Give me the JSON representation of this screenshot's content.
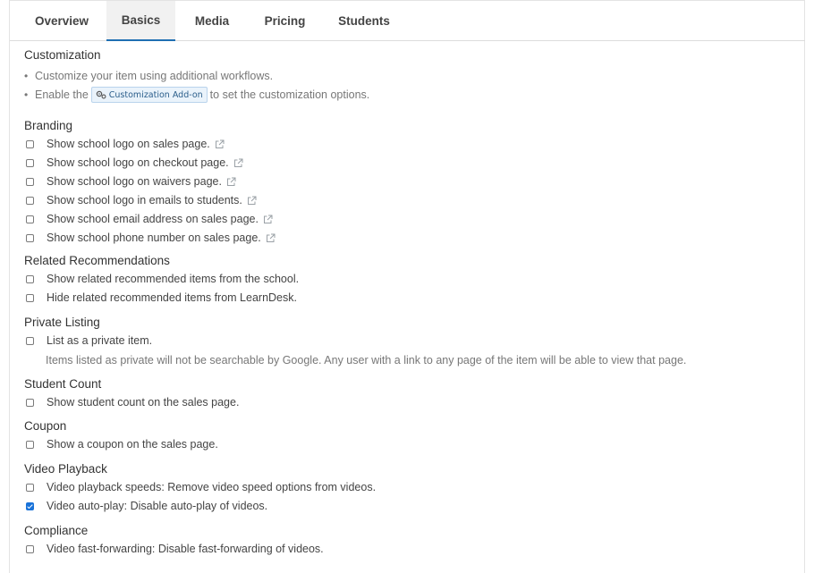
{
  "tabs": [
    "Overview",
    "Basics",
    "Media",
    "Pricing",
    "Students"
  ],
  "active_tab": "Basics",
  "customization": {
    "title": "Customization",
    "bullet1": "Customize your item using additional workflows.",
    "bullet2_prefix": "Enable the",
    "addon_label": "Customization Add-on",
    "bullet2_suffix": "to set the customization options."
  },
  "branding": {
    "title": "Branding",
    "items": [
      {
        "label": "Show school logo on sales page.",
        "checked": false
      },
      {
        "label": "Show school logo on checkout page.",
        "checked": false
      },
      {
        "label": "Show school logo on waivers page.",
        "checked": false
      },
      {
        "label": "Show school logo in emails to students.",
        "checked": false
      },
      {
        "label": "Show school email address on sales page.",
        "checked": false
      },
      {
        "label": "Show school phone number on sales page.",
        "checked": false
      }
    ]
  },
  "related": {
    "title": "Related Recommendations",
    "items": [
      {
        "label": "Show related recommended items from the school.",
        "checked": false
      },
      {
        "label": "Hide related recommended items from LearnDesk.",
        "checked": false
      }
    ]
  },
  "private_listing": {
    "title": "Private Listing",
    "item": {
      "label": "List as a private item.",
      "checked": false
    },
    "helper": "Items listed as private will not be searchable by Google. Any user with a link to any page of the item will be able to view that page."
  },
  "student_count": {
    "title": "Student Count",
    "item": {
      "label": "Show student count on the sales page.",
      "checked": false
    }
  },
  "coupon": {
    "title": "Coupon",
    "item": {
      "label": "Show a coupon on the sales page.",
      "checked": false
    }
  },
  "video_playback": {
    "title": "Video Playback",
    "items": [
      {
        "label": "Video playback speeds: Remove video speed options from videos.",
        "checked": false
      },
      {
        "label": "Video auto-play: Disable auto-play of videos.",
        "checked": true
      }
    ]
  },
  "compliance": {
    "title": "Compliance",
    "item": {
      "label": "Video fast-forwarding: Disable fast-forwarding of videos.",
      "checked": false
    }
  },
  "colors": {
    "accent": "#1f6fb3",
    "checkbox_checked": "#1a73d9"
  }
}
